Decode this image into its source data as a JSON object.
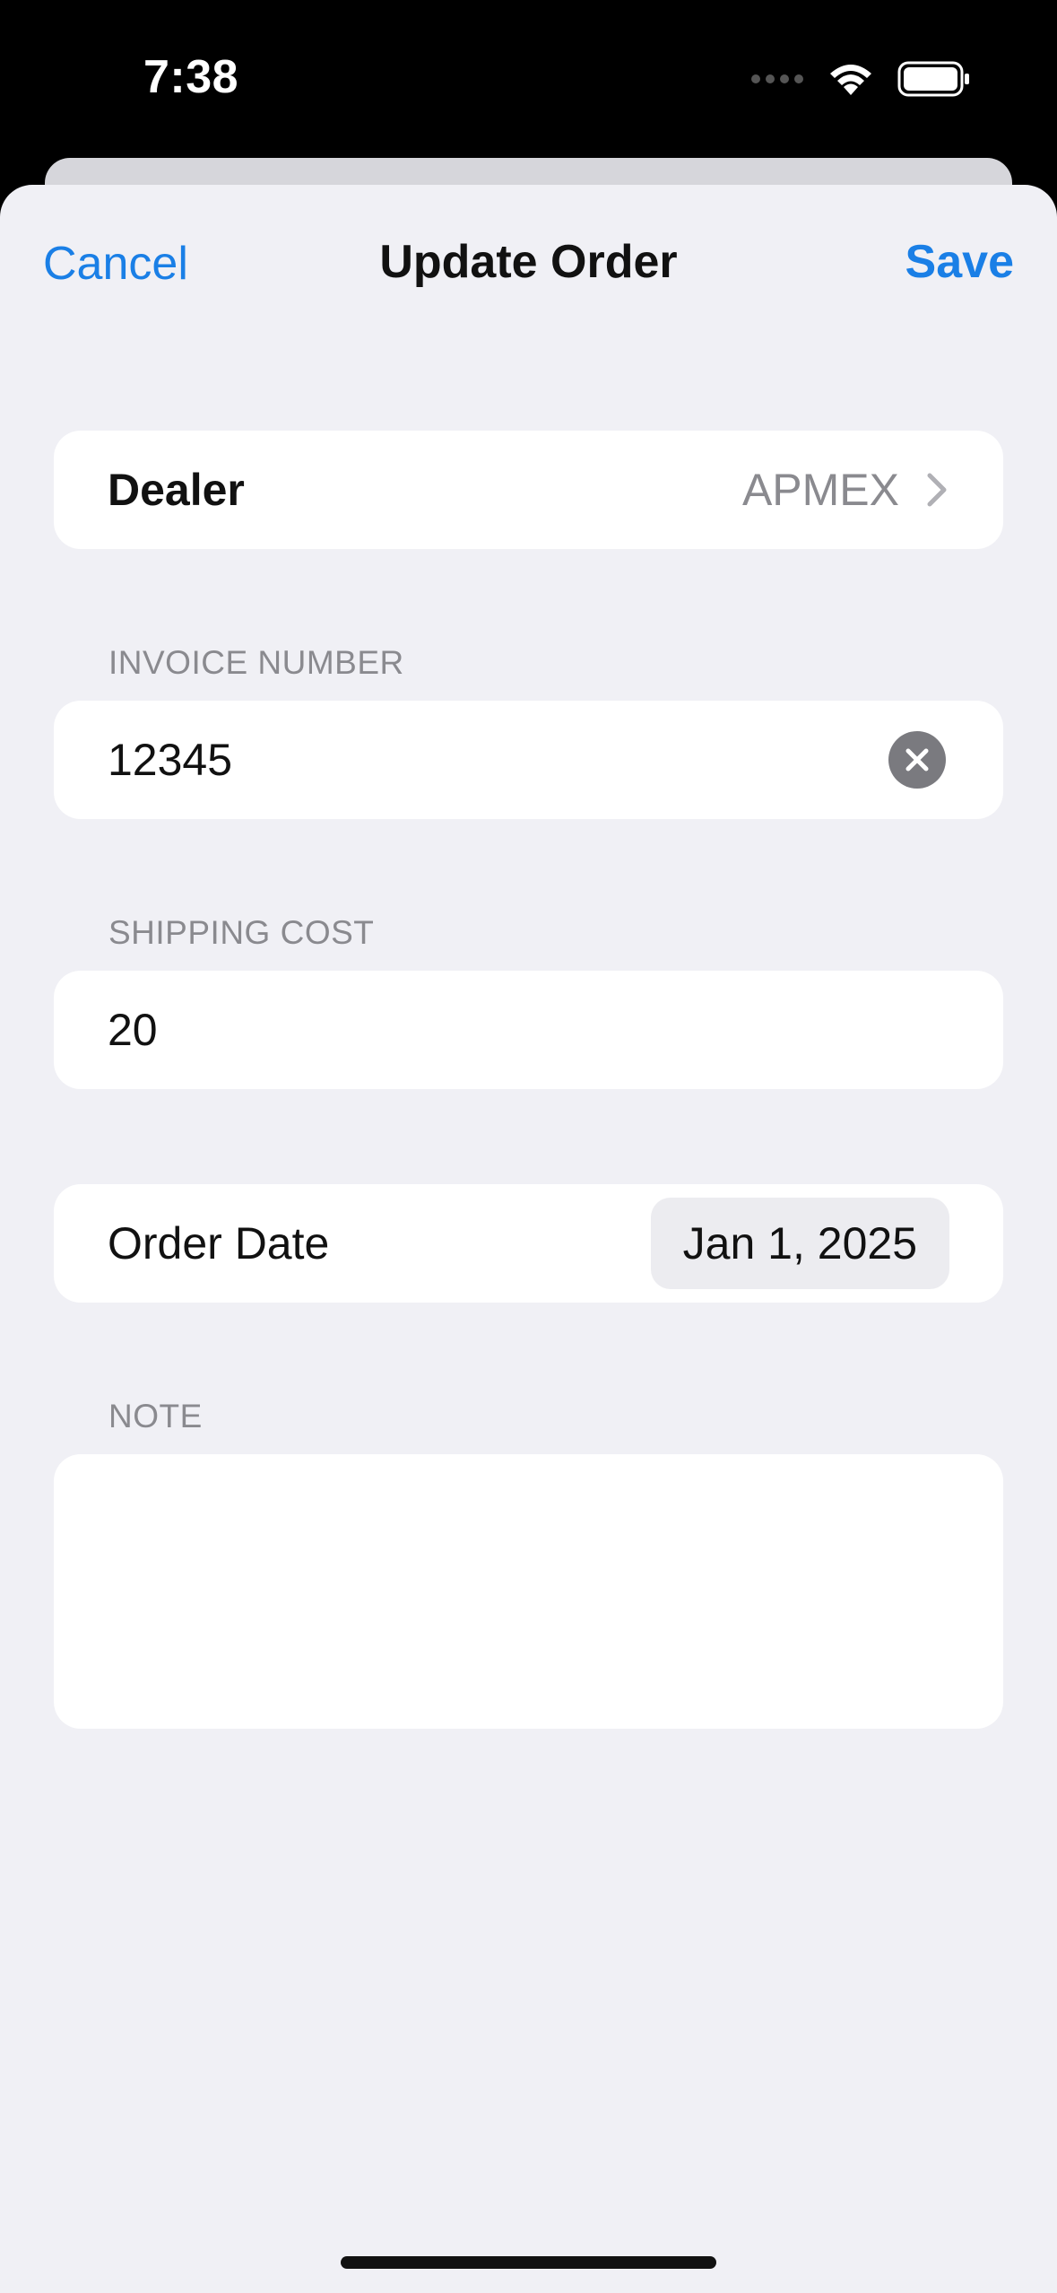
{
  "status_bar": {
    "time": "7:38",
    "icons": [
      "signal-icon",
      "wifi-icon",
      "battery-icon"
    ]
  },
  "nav": {
    "cancel_label": "Cancel",
    "title": "Update Order",
    "save_label": "Save"
  },
  "form": {
    "dealer": {
      "label": "Dealer",
      "value": "APMEX"
    },
    "invoice": {
      "header": "INVOICE NUMBER",
      "value": "12345"
    },
    "shipping": {
      "header": "SHIPPING COST",
      "value": "20"
    },
    "order_date": {
      "label": "Order Date",
      "value": "Jan 1, 2025"
    },
    "note": {
      "header": "NOTE",
      "value": ""
    }
  },
  "colors": {
    "accent": "#1a7fe6",
    "background": "#f0f0f5",
    "card": "#ffffff",
    "muted_text": "#8a8a8f"
  }
}
